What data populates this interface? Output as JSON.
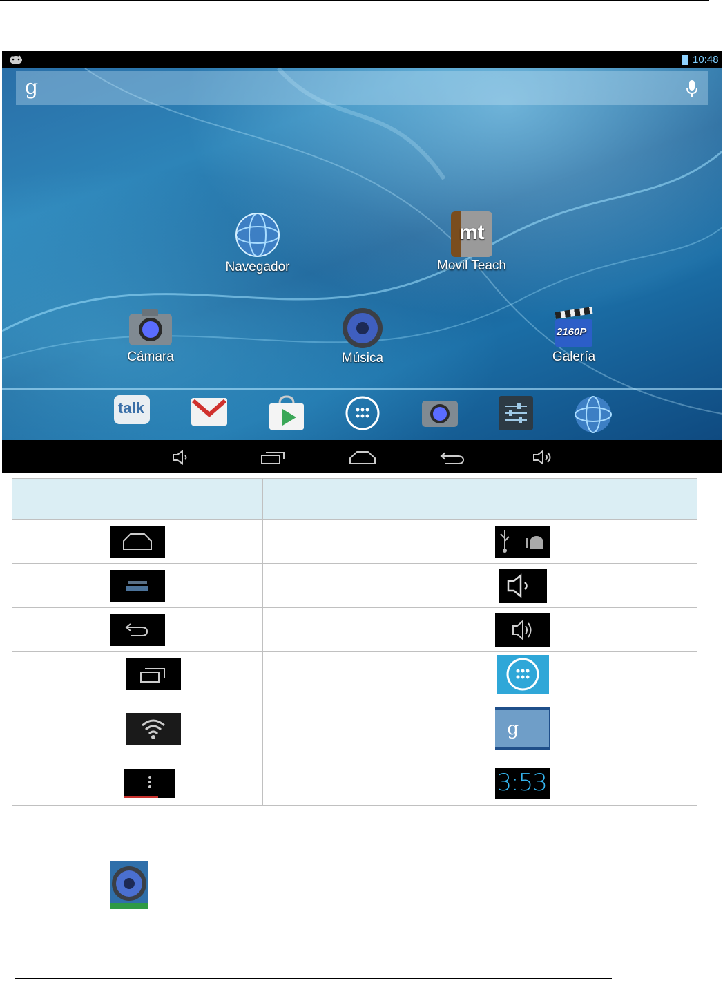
{
  "status_bar": {
    "time": "10:48",
    "left_icon": "android-debug-icon",
    "battery_icon": "battery-charging-icon"
  },
  "search": {
    "logo": "g",
    "mic_icon": "mic-icon"
  },
  "home_apps": [
    {
      "label": "Navegador",
      "icon": "globe-icon"
    },
    {
      "label": "Movil Teach",
      "icon": "mt-book-icon",
      "icon_text": "mt"
    },
    {
      "label": "Cámara",
      "icon": "camera-icon"
    },
    {
      "label": "Música",
      "icon": "speaker-icon"
    },
    {
      "label": "Galería",
      "icon": "clapperboard-icon",
      "icon_text": "2160P"
    }
  ],
  "dock": [
    {
      "icon": "talk-icon",
      "icon_text": "talk"
    },
    {
      "icon": "gmail-icon"
    },
    {
      "icon": "play-store-icon"
    },
    {
      "icon": "app-drawer-icon"
    },
    {
      "icon": "camera-icon"
    },
    {
      "icon": "settings-icon"
    },
    {
      "icon": "globe-icon"
    }
  ],
  "nav_bar": [
    "volume-down-icon",
    "recent-apps-icon",
    "home-icon",
    "back-icon",
    "volume-up-icon"
  ],
  "table": {
    "headers": [
      "",
      "",
      "",
      ""
    ],
    "rows": [
      {
        "left_icon": "home-icon",
        "left_text": "",
        "right_icon": "usb-debug-icon",
        "right_text": ""
      },
      {
        "left_icon": "blurred-bars-icon",
        "left_text": "",
        "right_icon": "volume-down-icon",
        "right_text": ""
      },
      {
        "left_icon": "back-icon",
        "left_text": "",
        "right_icon": "volume-up-icon",
        "right_text": ""
      },
      {
        "left_icon": "recent-apps-icon",
        "left_text": "",
        "right_icon": "app-drawer-icon",
        "right_text": ""
      },
      {
        "left_icon": "wifi-icon",
        "left_text": "",
        "right_icon": "google-search-icon",
        "right_text": ""
      },
      {
        "left_icon": "overflow-menu-icon",
        "left_text": "",
        "right_icon": "clock-widget-icon",
        "right_text": ""
      }
    ],
    "clock_widget_time": "3:53",
    "google_logo": "g"
  },
  "footer_icon": "speaker-icon"
}
